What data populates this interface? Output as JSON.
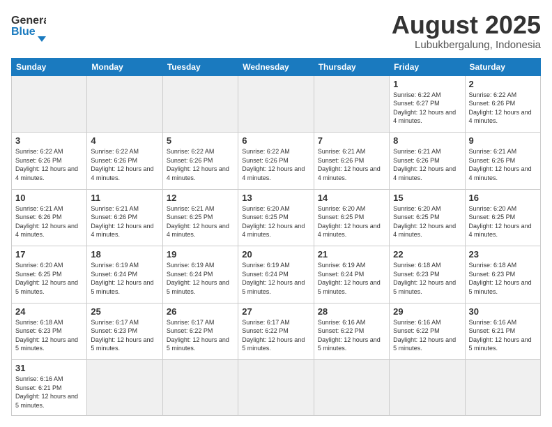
{
  "header": {
    "logo_general": "General",
    "logo_blue": "Blue",
    "month_title": "August 2025",
    "location": "Lubukbergalung, Indonesia"
  },
  "weekdays": [
    "Sunday",
    "Monday",
    "Tuesday",
    "Wednesday",
    "Thursday",
    "Friday",
    "Saturday"
  ],
  "weeks": [
    [
      {
        "day": "",
        "info": "",
        "empty": true
      },
      {
        "day": "",
        "info": "",
        "empty": true
      },
      {
        "day": "",
        "info": "",
        "empty": true
      },
      {
        "day": "",
        "info": "",
        "empty": true
      },
      {
        "day": "",
        "info": "",
        "empty": true
      },
      {
        "day": "1",
        "info": "Sunrise: 6:22 AM\nSunset: 6:27 PM\nDaylight: 12 hours and 4 minutes."
      },
      {
        "day": "2",
        "info": "Sunrise: 6:22 AM\nSunset: 6:26 PM\nDaylight: 12 hours and 4 minutes."
      }
    ],
    [
      {
        "day": "3",
        "info": "Sunrise: 6:22 AM\nSunset: 6:26 PM\nDaylight: 12 hours and 4 minutes."
      },
      {
        "day": "4",
        "info": "Sunrise: 6:22 AM\nSunset: 6:26 PM\nDaylight: 12 hours and 4 minutes."
      },
      {
        "day": "5",
        "info": "Sunrise: 6:22 AM\nSunset: 6:26 PM\nDaylight: 12 hours and 4 minutes."
      },
      {
        "day": "6",
        "info": "Sunrise: 6:22 AM\nSunset: 6:26 PM\nDaylight: 12 hours and 4 minutes."
      },
      {
        "day": "7",
        "info": "Sunrise: 6:21 AM\nSunset: 6:26 PM\nDaylight: 12 hours and 4 minutes."
      },
      {
        "day": "8",
        "info": "Sunrise: 6:21 AM\nSunset: 6:26 PM\nDaylight: 12 hours and 4 minutes."
      },
      {
        "day": "9",
        "info": "Sunrise: 6:21 AM\nSunset: 6:26 PM\nDaylight: 12 hours and 4 minutes."
      }
    ],
    [
      {
        "day": "10",
        "info": "Sunrise: 6:21 AM\nSunset: 6:26 PM\nDaylight: 12 hours and 4 minutes."
      },
      {
        "day": "11",
        "info": "Sunrise: 6:21 AM\nSunset: 6:26 PM\nDaylight: 12 hours and 4 minutes."
      },
      {
        "day": "12",
        "info": "Sunrise: 6:21 AM\nSunset: 6:25 PM\nDaylight: 12 hours and 4 minutes."
      },
      {
        "day": "13",
        "info": "Sunrise: 6:20 AM\nSunset: 6:25 PM\nDaylight: 12 hours and 4 minutes."
      },
      {
        "day": "14",
        "info": "Sunrise: 6:20 AM\nSunset: 6:25 PM\nDaylight: 12 hours and 4 minutes."
      },
      {
        "day": "15",
        "info": "Sunrise: 6:20 AM\nSunset: 6:25 PM\nDaylight: 12 hours and 4 minutes."
      },
      {
        "day": "16",
        "info": "Sunrise: 6:20 AM\nSunset: 6:25 PM\nDaylight: 12 hours and 4 minutes."
      }
    ],
    [
      {
        "day": "17",
        "info": "Sunrise: 6:20 AM\nSunset: 6:25 PM\nDaylight: 12 hours and 5 minutes."
      },
      {
        "day": "18",
        "info": "Sunrise: 6:19 AM\nSunset: 6:24 PM\nDaylight: 12 hours and 5 minutes."
      },
      {
        "day": "19",
        "info": "Sunrise: 6:19 AM\nSunset: 6:24 PM\nDaylight: 12 hours and 5 minutes."
      },
      {
        "day": "20",
        "info": "Sunrise: 6:19 AM\nSunset: 6:24 PM\nDaylight: 12 hours and 5 minutes."
      },
      {
        "day": "21",
        "info": "Sunrise: 6:19 AM\nSunset: 6:24 PM\nDaylight: 12 hours and 5 minutes."
      },
      {
        "day": "22",
        "info": "Sunrise: 6:18 AM\nSunset: 6:23 PM\nDaylight: 12 hours and 5 minutes."
      },
      {
        "day": "23",
        "info": "Sunrise: 6:18 AM\nSunset: 6:23 PM\nDaylight: 12 hours and 5 minutes."
      }
    ],
    [
      {
        "day": "24",
        "info": "Sunrise: 6:18 AM\nSunset: 6:23 PM\nDaylight: 12 hours and 5 minutes."
      },
      {
        "day": "25",
        "info": "Sunrise: 6:17 AM\nSunset: 6:23 PM\nDaylight: 12 hours and 5 minutes."
      },
      {
        "day": "26",
        "info": "Sunrise: 6:17 AM\nSunset: 6:22 PM\nDaylight: 12 hours and 5 minutes."
      },
      {
        "day": "27",
        "info": "Sunrise: 6:17 AM\nSunset: 6:22 PM\nDaylight: 12 hours and 5 minutes."
      },
      {
        "day": "28",
        "info": "Sunrise: 6:16 AM\nSunset: 6:22 PM\nDaylight: 12 hours and 5 minutes."
      },
      {
        "day": "29",
        "info": "Sunrise: 6:16 AM\nSunset: 6:22 PM\nDaylight: 12 hours and 5 minutes."
      },
      {
        "day": "30",
        "info": "Sunrise: 6:16 AM\nSunset: 6:21 PM\nDaylight: 12 hours and 5 minutes."
      }
    ],
    [
      {
        "day": "31",
        "info": "Sunrise: 6:16 AM\nSunset: 6:21 PM\nDaylight: 12 hours and 5 minutes."
      },
      {
        "day": "",
        "info": "",
        "empty": true
      },
      {
        "day": "",
        "info": "",
        "empty": true
      },
      {
        "day": "",
        "info": "",
        "empty": true
      },
      {
        "day": "",
        "info": "",
        "empty": true
      },
      {
        "day": "",
        "info": "",
        "empty": true
      },
      {
        "day": "",
        "info": "",
        "empty": true
      }
    ]
  ]
}
